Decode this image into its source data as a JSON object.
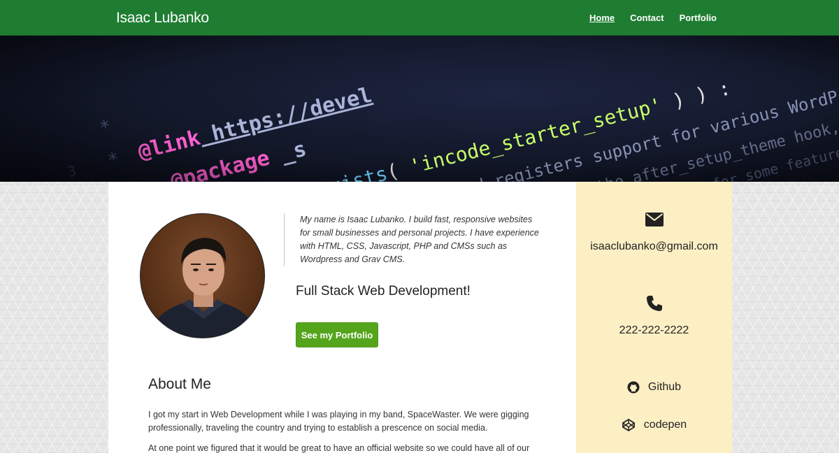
{
  "nav": {
    "brand": "Isaac Lubanko",
    "links": [
      {
        "label": "Home",
        "active": true
      },
      {
        "label": "Contact",
        "active": false
      },
      {
        "label": "Portfolio",
        "active": false
      }
    ]
  },
  "hero": {
    "code_lines": [
      "@link https://devel",
      "@package _s",
      "function_exists( 'incode_starter_setup' ) ) :",
      "faults and registers support for various WordPress fe",
      "hooked into the after_setup_theme hook, which",
      "if hook is too late for some features, such"
    ]
  },
  "intro": {
    "bio": "My name is Isaac Lubanko. I build fast, responsive websites for small businesses and personal projects. I have experience with HTML, CSS, Javascript, PHP and CMSs such as Wordpress and Grav CMS.",
    "headline": "Full Stack Web Development!",
    "cta_label": "See my Portfolio"
  },
  "about": {
    "title": "About Me",
    "paragraph1": "I got my start in Web Development while I was playing in my band, SpaceWaster. We were gigging professionally, traveling the country and trying to establish a prescence on social media.",
    "paragraph2": "At one point we figured that it would be great to have an official website so we could have all of our"
  },
  "sidebar": {
    "email": "isaaclubanko@gmail.com",
    "phone": "222-222-2222",
    "github_label": "Github",
    "codepen_label": "codepen",
    "icons": [
      "envelope-icon",
      "phone-icon",
      "github-icon",
      "codepen-icon"
    ]
  },
  "colors": {
    "navbar": "#1f7d32",
    "button": "#55a51c",
    "sidebar": "#fdefc4",
    "code_pink": "#ff5fd0",
    "code_green": "#c8ff6a"
  }
}
